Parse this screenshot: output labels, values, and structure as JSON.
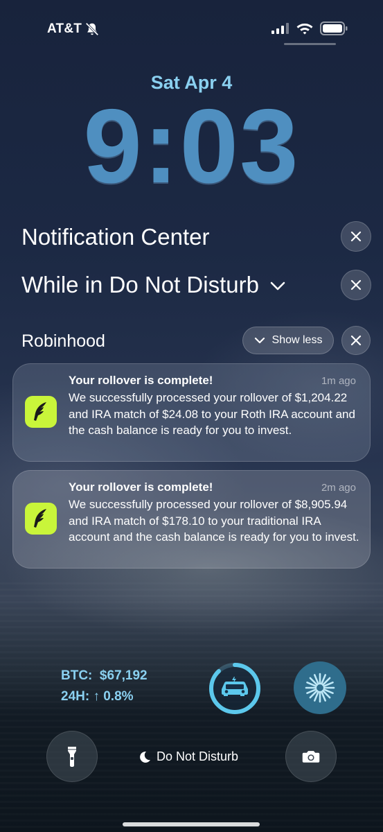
{
  "status_bar": {
    "carrier": "AT&T",
    "icons": [
      "bell-slash-icon",
      "signal-icon",
      "wifi-icon",
      "battery-icon"
    ]
  },
  "lock_screen": {
    "date": "Sat Apr 4",
    "time": "9:03"
  },
  "notification_center": {
    "title": "Notification Center",
    "dnd_section": "While in Do Not Disturb",
    "group": {
      "app_name": "Robinhood",
      "show_less_label": "Show less",
      "notifications": [
        {
          "title": "Your rollover is complete!",
          "time": "1m ago",
          "body": "We successfully processed your rollover of $1,204.22  and IRA match of $24.08 to your Roth IRA account and the cash balance is ready for you to invest."
        },
        {
          "title": "Your rollover is complete!",
          "time": "2m ago",
          "body": "We successfully processed your rollover of $8,905.94  and IRA match of $178.10 to your traditional IRA account and the cash balance is ready for you to invest."
        }
      ]
    }
  },
  "widgets": {
    "btc": "BTC:  $67,192",
    "change": "24H: ↑ 0.8%",
    "car_progress": 0.88
  },
  "bottom_controls": {
    "focus_label": "Do Not Disturb"
  },
  "colors": {
    "accent": "#8ad0f0",
    "clock": "#4f8fc0",
    "robinhood": "#c9f53a"
  }
}
